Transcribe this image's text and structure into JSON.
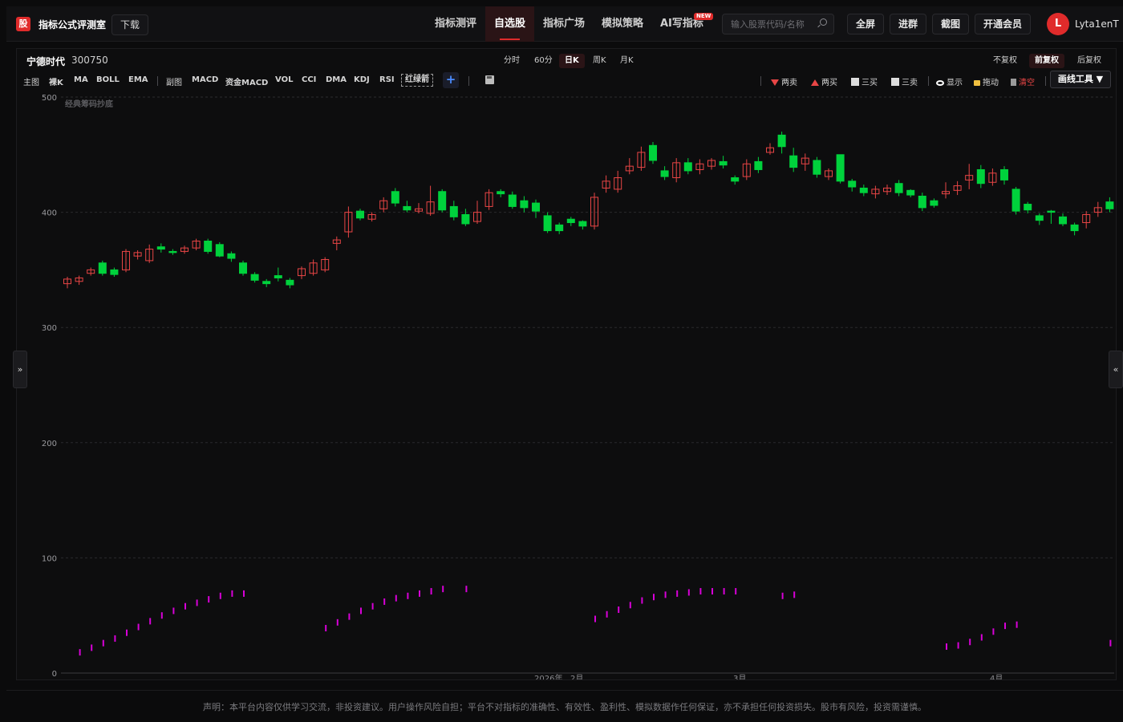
{
  "header": {
    "logo": "股",
    "title": "指标公式评测室",
    "download": "下载",
    "nav": [
      "指标测评",
      "自选股",
      "指标广场",
      "模拟策略",
      "AI写指标"
    ],
    "new_badge": "NEW",
    "search_placeholder": "输入股票代码/名称",
    "buttons": [
      "全屏",
      "进群",
      "截图",
      "开通会员"
    ],
    "avatar": "L",
    "username": "Lyta1enT"
  },
  "stock": {
    "name": "宁德时代",
    "code": "300750"
  },
  "periods": {
    "items": [
      "分时",
      "60分",
      "日K",
      "周K",
      "月K"
    ],
    "active": "日K"
  },
  "adjust": {
    "items": [
      "不复权",
      "前复权",
      "后复权"
    ],
    "active": "前复权"
  },
  "indicators": {
    "main_label": "主图",
    "main": [
      "裸K",
      "MA",
      "BOLL",
      "EMA"
    ],
    "sub_label": "副图",
    "sub": [
      "MACD",
      "资金MACD",
      "VOL",
      "CCI",
      "DMA",
      "KDJ",
      "RSI"
    ],
    "custom": "红绿箭",
    "add": "+"
  },
  "tools": [
    "两卖",
    "两买",
    "三买",
    "三卖",
    "显示",
    "拖动",
    "清空"
  ],
  "draw_tool": "画线工具 ▼",
  "toggles": {
    "left": "»",
    "right": "«"
  },
  "footer": "声明：本平台内容仅供学习交流，非投资建议。用户操作风险自担；平台不对指标的准确性、有效性、盈利性、模拟数据作任何保证，亦不承担任何投资损失。股市有风险，投资需谨慎。",
  "colors": {
    "up": "#e84545",
    "down": "#00d23c",
    "indicator": "#d800d8",
    "accent": "#e02b2b"
  },
  "chart_data": {
    "type": "candlestick",
    "indicator_label": "经典筹码抄底",
    "ylim": [
      0,
      500
    ],
    "yticks": [
      0,
      100,
      200,
      300,
      400,
      500
    ],
    "xlabels": [
      "2026年",
      "2月",
      "3月",
      "4月"
    ],
    "candles": [
      [
        338,
        342,
        334,
        344
      ],
      [
        340,
        343,
        337,
        345
      ],
      [
        347,
        350,
        345,
        352
      ],
      [
        356,
        347,
        345,
        358
      ],
      [
        350,
        346,
        344,
        352
      ],
      [
        350,
        366,
        348,
        368
      ],
      [
        362,
        365,
        359,
        367
      ],
      [
        358,
        368,
        356,
        372
      ],
      [
        370,
        368,
        365,
        373
      ],
      [
        366,
        365,
        363,
        368
      ],
      [
        366,
        369,
        364,
        371
      ],
      [
        369,
        375,
        367,
        377
      ],
      [
        375,
        366,
        364,
        377
      ],
      [
        372,
        362,
        361,
        374
      ],
      [
        364,
        360,
        357,
        366
      ],
      [
        356,
        347,
        345,
        358
      ],
      [
        346,
        341,
        339,
        348
      ],
      [
        340,
        338,
        335,
        342
      ],
      [
        345,
        343,
        340,
        352
      ],
      [
        341,
        337,
        334,
        343
      ],
      [
        345,
        351,
        342,
        353
      ],
      [
        347,
        356,
        345,
        359
      ],
      [
        350,
        359,
        348,
        361
      ],
      [
        373,
        376,
        367,
        379
      ],
      [
        383,
        400,
        378,
        405
      ],
      [
        401,
        395,
        393,
        403
      ],
      [
        394,
        398,
        392,
        400
      ],
      [
        403,
        410,
        400,
        413
      ],
      [
        418,
        408,
        405,
        421
      ],
      [
        405,
        402,
        400,
        410
      ],
      [
        401,
        403,
        399,
        408
      ],
      [
        399,
        409,
        397,
        423
      ],
      [
        418,
        402,
        400,
        420
      ],
      [
        405,
        396,
        393,
        410
      ],
      [
        398,
        390,
        388,
        403
      ],
      [
        392,
        400,
        390,
        410
      ],
      [
        405,
        417,
        402,
        420
      ],
      [
        418,
        416,
        413,
        420
      ],
      [
        415,
        405,
        403,
        418
      ],
      [
        410,
        404,
        400,
        414
      ],
      [
        408,
        401,
        395,
        411
      ],
      [
        397,
        384,
        382,
        400
      ],
      [
        389,
        384,
        381,
        391
      ],
      [
        394,
        391,
        388,
        396
      ],
      [
        392,
        388,
        385,
        393
      ],
      [
        388,
        413,
        385,
        417
      ],
      [
        421,
        427,
        417,
        432
      ],
      [
        420,
        430,
        417,
        436
      ],
      [
        436,
        440,
        433,
        447
      ],
      [
        439,
        452,
        436,
        457
      ],
      [
        458,
        445,
        442,
        461
      ],
      [
        436,
        431,
        428,
        440
      ],
      [
        430,
        443,
        426,
        447
      ],
      [
        443,
        436,
        433,
        447
      ],
      [
        437,
        442,
        433,
        446
      ],
      [
        440,
        445,
        437,
        447
      ],
      [
        444,
        441,
        438,
        449
      ],
      [
        430,
        427,
        424,
        432
      ],
      [
        431,
        442,
        428,
        446
      ],
      [
        444,
        437,
        434,
        448
      ],
      [
        452,
        456,
        450,
        460
      ],
      [
        467,
        457,
        451,
        470
      ],
      [
        449,
        439,
        435,
        456
      ],
      [
        442,
        447,
        436,
        451
      ],
      [
        445,
        433,
        430,
        448
      ],
      [
        431,
        436,
        428,
        438
      ],
      [
        450,
        427,
        425,
        450
      ],
      [
        427,
        422,
        418,
        429
      ],
      [
        421,
        417,
        414,
        424
      ],
      [
        416,
        420,
        412,
        423
      ],
      [
        418,
        421,
        415,
        424
      ],
      [
        425,
        417,
        414,
        428
      ],
      [
        419,
        415,
        413,
        420
      ],
      [
        414,
        404,
        401,
        417
      ],
      [
        410,
        406,
        404,
        412
      ],
      [
        416,
        418,
        412,
        426
      ],
      [
        419,
        423,
        415,
        427
      ],
      [
        428,
        432,
        420,
        442
      ],
      [
        437,
        425,
        421,
        441
      ],
      [
        426,
        434,
        423,
        438
      ],
      [
        437,
        428,
        424,
        440
      ],
      [
        420,
        401,
        398,
        422
      ],
      [
        407,
        402,
        399,
        409
      ],
      [
        397,
        393,
        389,
        399
      ],
      [
        401,
        400,
        390,
        402
      ],
      [
        396,
        390,
        388,
        399
      ],
      [
        389,
        384,
        380,
        391
      ],
      [
        391,
        398,
        386,
        401
      ],
      [
        400,
        404,
        396,
        409
      ],
      [
        409,
        403,
        400,
        413
      ]
    ],
    "indicator_series": [
      [
        1,
        18
      ],
      [
        2,
        22
      ],
      [
        3,
        26
      ],
      [
        4,
        30
      ],
      [
        5,
        35
      ],
      [
        6,
        40
      ],
      [
        7,
        45
      ],
      [
        8,
        50
      ],
      [
        9,
        54
      ],
      [
        10,
        58
      ],
      [
        11,
        61
      ],
      [
        12,
        64
      ],
      [
        13,
        67
      ],
      [
        14,
        69
      ],
      [
        15,
        69
      ],
      [
        22,
        39
      ],
      [
        23,
        44
      ],
      [
        24,
        49
      ],
      [
        25,
        54
      ],
      [
        26,
        58
      ],
      [
        27,
        62
      ],
      [
        28,
        65
      ],
      [
        29,
        67
      ],
      [
        30,
        69
      ],
      [
        31,
        71
      ],
      [
        32,
        73
      ],
      [
        34,
        73
      ],
      [
        45,
        47
      ],
      [
        46,
        51
      ],
      [
        47,
        55
      ],
      [
        48,
        59
      ],
      [
        49,
        63
      ],
      [
        50,
        66
      ],
      [
        51,
        68
      ],
      [
        52,
        69
      ],
      [
        53,
        70
      ],
      [
        54,
        71
      ],
      [
        55,
        71
      ],
      [
        56,
        71
      ],
      [
        57,
        71
      ],
      [
        61,
        67
      ],
      [
        62,
        68
      ],
      [
        75,
        23
      ],
      [
        76,
        24
      ],
      [
        77,
        27
      ],
      [
        78,
        31
      ],
      [
        79,
        36
      ],
      [
        80,
        41
      ],
      [
        81,
        42
      ],
      [
        89,
        26
      ],
      [
        90,
        28
      ]
    ]
  }
}
